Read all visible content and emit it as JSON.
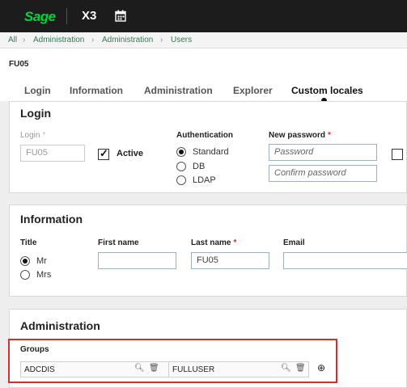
{
  "app": {
    "brand": "Sage",
    "product": "X3"
  },
  "breadcrumb": [
    "All",
    "Administration",
    "Administration",
    "Users"
  ],
  "record": {
    "id": "FU05"
  },
  "tabs": [
    "Login",
    "Information",
    "Administration",
    "Explorer",
    "Custom locales"
  ],
  "active_tab": "Custom locales",
  "login": {
    "title": "Login",
    "login_label": "Login",
    "login_value": "FU05",
    "active_label": "Active",
    "active_checked": true,
    "auth_label": "Authentication",
    "auth_options": [
      "Standard",
      "DB",
      "LDAP"
    ],
    "auth_selected": "Standard",
    "new_password_label": "New password",
    "password_placeholder": "Password",
    "confirm_placeholder": "Confirm password"
  },
  "information": {
    "title": "Information",
    "title_label": "Title",
    "title_options": [
      "Mr",
      "Mrs"
    ],
    "title_selected": "Mr",
    "first_name_label": "First name",
    "first_name_value": "",
    "last_name_label": "Last name",
    "last_name_value": "FU05",
    "email_label": "Email",
    "email_value": ""
  },
  "administration": {
    "title": "Administration",
    "groups_label": "Groups",
    "groups": [
      "ADCDIS",
      "FULLUSER"
    ]
  },
  "colors": {
    "brand_green": "#00d639",
    "required": "#d32f2f",
    "topbar": "#1c1c1c",
    "highlight": "#d32f2f"
  }
}
